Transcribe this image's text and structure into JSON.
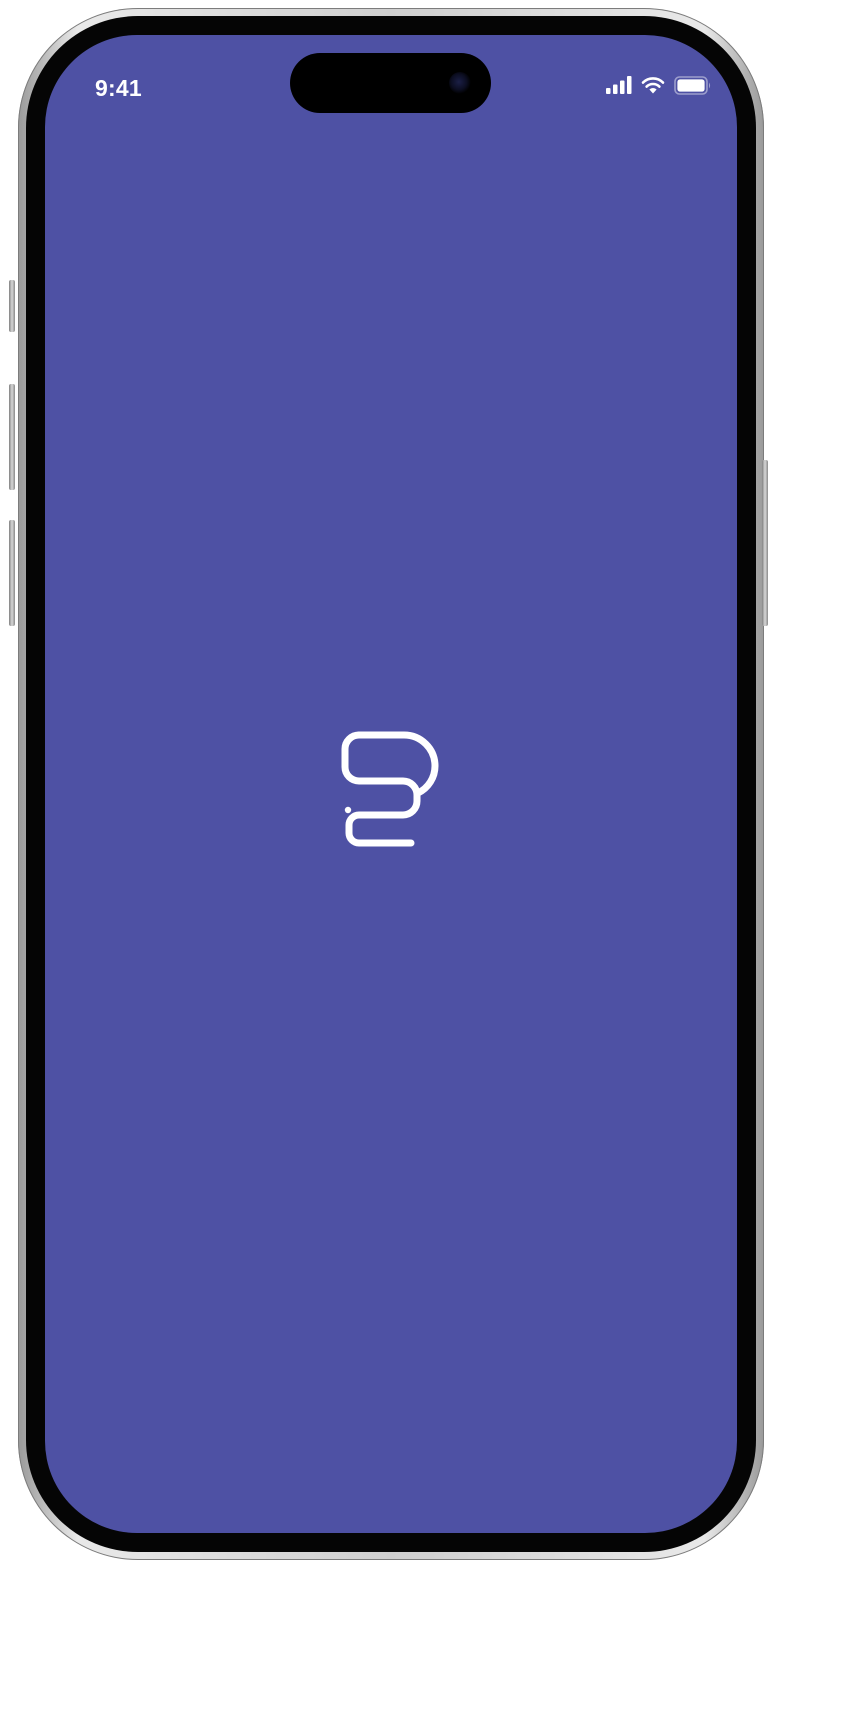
{
  "status_bar": {
    "time": "9:41",
    "icons": [
      "cellular-signal-icon",
      "wifi-icon",
      "battery-icon"
    ]
  },
  "splash": {
    "logo_icon": "app-logo-icon"
  },
  "colors": {
    "screen_background": "#4e51a4",
    "foreground": "#ffffff"
  }
}
